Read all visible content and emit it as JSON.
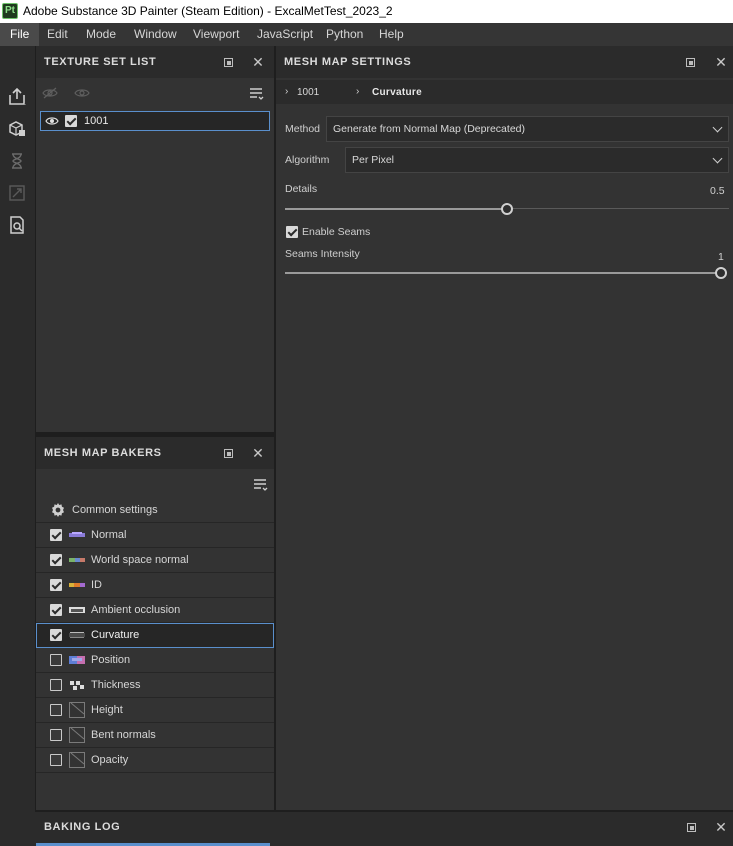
{
  "window": {
    "title": "Adobe Substance 3D Painter (Steam Edition) - ExcalMetTest_2023_2",
    "logo_text": "Pt"
  },
  "menu": [
    "File",
    "Edit",
    "Mode",
    "Window",
    "Viewport",
    "JavaScript",
    "Python",
    "Help"
  ],
  "texture_set_list": {
    "title": "TEXTURE SET LIST",
    "items": [
      {
        "label": "1001",
        "visible": true,
        "checked": true
      }
    ]
  },
  "mesh_map_settings": {
    "title": "MESH MAP SETTINGS",
    "breadcrumb": [
      "1001",
      "Curvature"
    ],
    "method": {
      "label": "Method",
      "value": "Generate from Normal Map (Deprecated)"
    },
    "algorithm": {
      "label": "Algorithm",
      "value": "Per Pixel"
    },
    "details": {
      "label": "Details",
      "value": "0.5"
    },
    "enable_seams": {
      "label": "Enable Seams",
      "checked": true
    },
    "seams_intensity": {
      "label": "Seams Intensity",
      "value": "1"
    }
  },
  "mesh_map_bakers": {
    "title": "MESH MAP BAKERS",
    "common_settings": "Common settings",
    "items": [
      {
        "label": "Normal",
        "checked": true
      },
      {
        "label": "World space normal",
        "checked": true
      },
      {
        "label": "ID",
        "checked": true
      },
      {
        "label": "Ambient occlusion",
        "checked": true
      },
      {
        "label": "Curvature",
        "checked": true
      },
      {
        "label": "Position",
        "checked": false
      },
      {
        "label": "Thickness",
        "checked": false
      },
      {
        "label": "Height",
        "checked": false
      },
      {
        "label": "Bent normals",
        "checked": false
      },
      {
        "label": "Opacity",
        "checked": false
      }
    ]
  },
  "baking_log": {
    "title": "BAKING LOG"
  },
  "colors": {
    "accent": "#5a8fcc",
    "panel_bg": "#333333",
    "window_bg": "#2b2b2b"
  }
}
